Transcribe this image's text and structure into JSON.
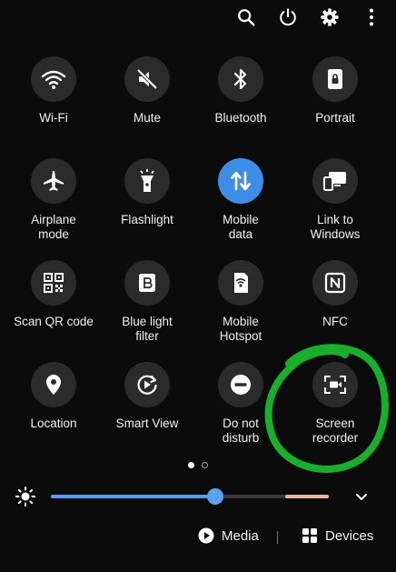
{
  "topbar": {
    "icons": [
      "search-icon",
      "power-icon",
      "gear-icon",
      "more-vert-icon"
    ]
  },
  "tiles": [
    {
      "label": "Wi-Fi",
      "icon": "wifi-icon",
      "active": false
    },
    {
      "label": "Mute",
      "icon": "mute-icon",
      "active": false
    },
    {
      "label": "Bluetooth",
      "icon": "bluetooth-icon",
      "active": false
    },
    {
      "label": "Portrait",
      "icon": "portrait-lock-icon",
      "active": false
    },
    {
      "label": "Airplane\nmode",
      "icon": "airplane-icon",
      "active": false
    },
    {
      "label": "Flashlight",
      "icon": "flashlight-icon",
      "active": false
    },
    {
      "label": "Mobile\ndata",
      "icon": "mobile-data-icon",
      "active": true
    },
    {
      "label": "Link to\nWindows",
      "icon": "link-to-windows-icon",
      "active": false
    },
    {
      "label": "Scan QR code",
      "icon": "qr-code-icon",
      "active": false
    },
    {
      "label": "Blue light\nfilter",
      "icon": "blue-light-filter-icon",
      "active": false
    },
    {
      "label": "Mobile\nHotspot",
      "icon": "hotspot-icon",
      "active": false
    },
    {
      "label": "NFC",
      "icon": "nfc-icon",
      "active": false
    },
    {
      "label": "Location",
      "icon": "location-icon",
      "active": false
    },
    {
      "label": "Smart View",
      "icon": "smart-view-icon",
      "active": false
    },
    {
      "label": "Do not\ndisturb",
      "icon": "do-not-disturb-icon",
      "active": false
    },
    {
      "label": "Screen\nrecorder",
      "icon": "screen-recorder-icon",
      "active": false
    }
  ],
  "pager": {
    "pages": 2,
    "current": 1
  },
  "brightness": {
    "level_fraction": 0.59
  },
  "bottom": {
    "media_label": "Media",
    "devices_label": "Devices"
  },
  "colors": {
    "accent": "#3d8ee6",
    "tile_bg": "#2b2b2b",
    "annotation_circle": "#17b02a"
  }
}
